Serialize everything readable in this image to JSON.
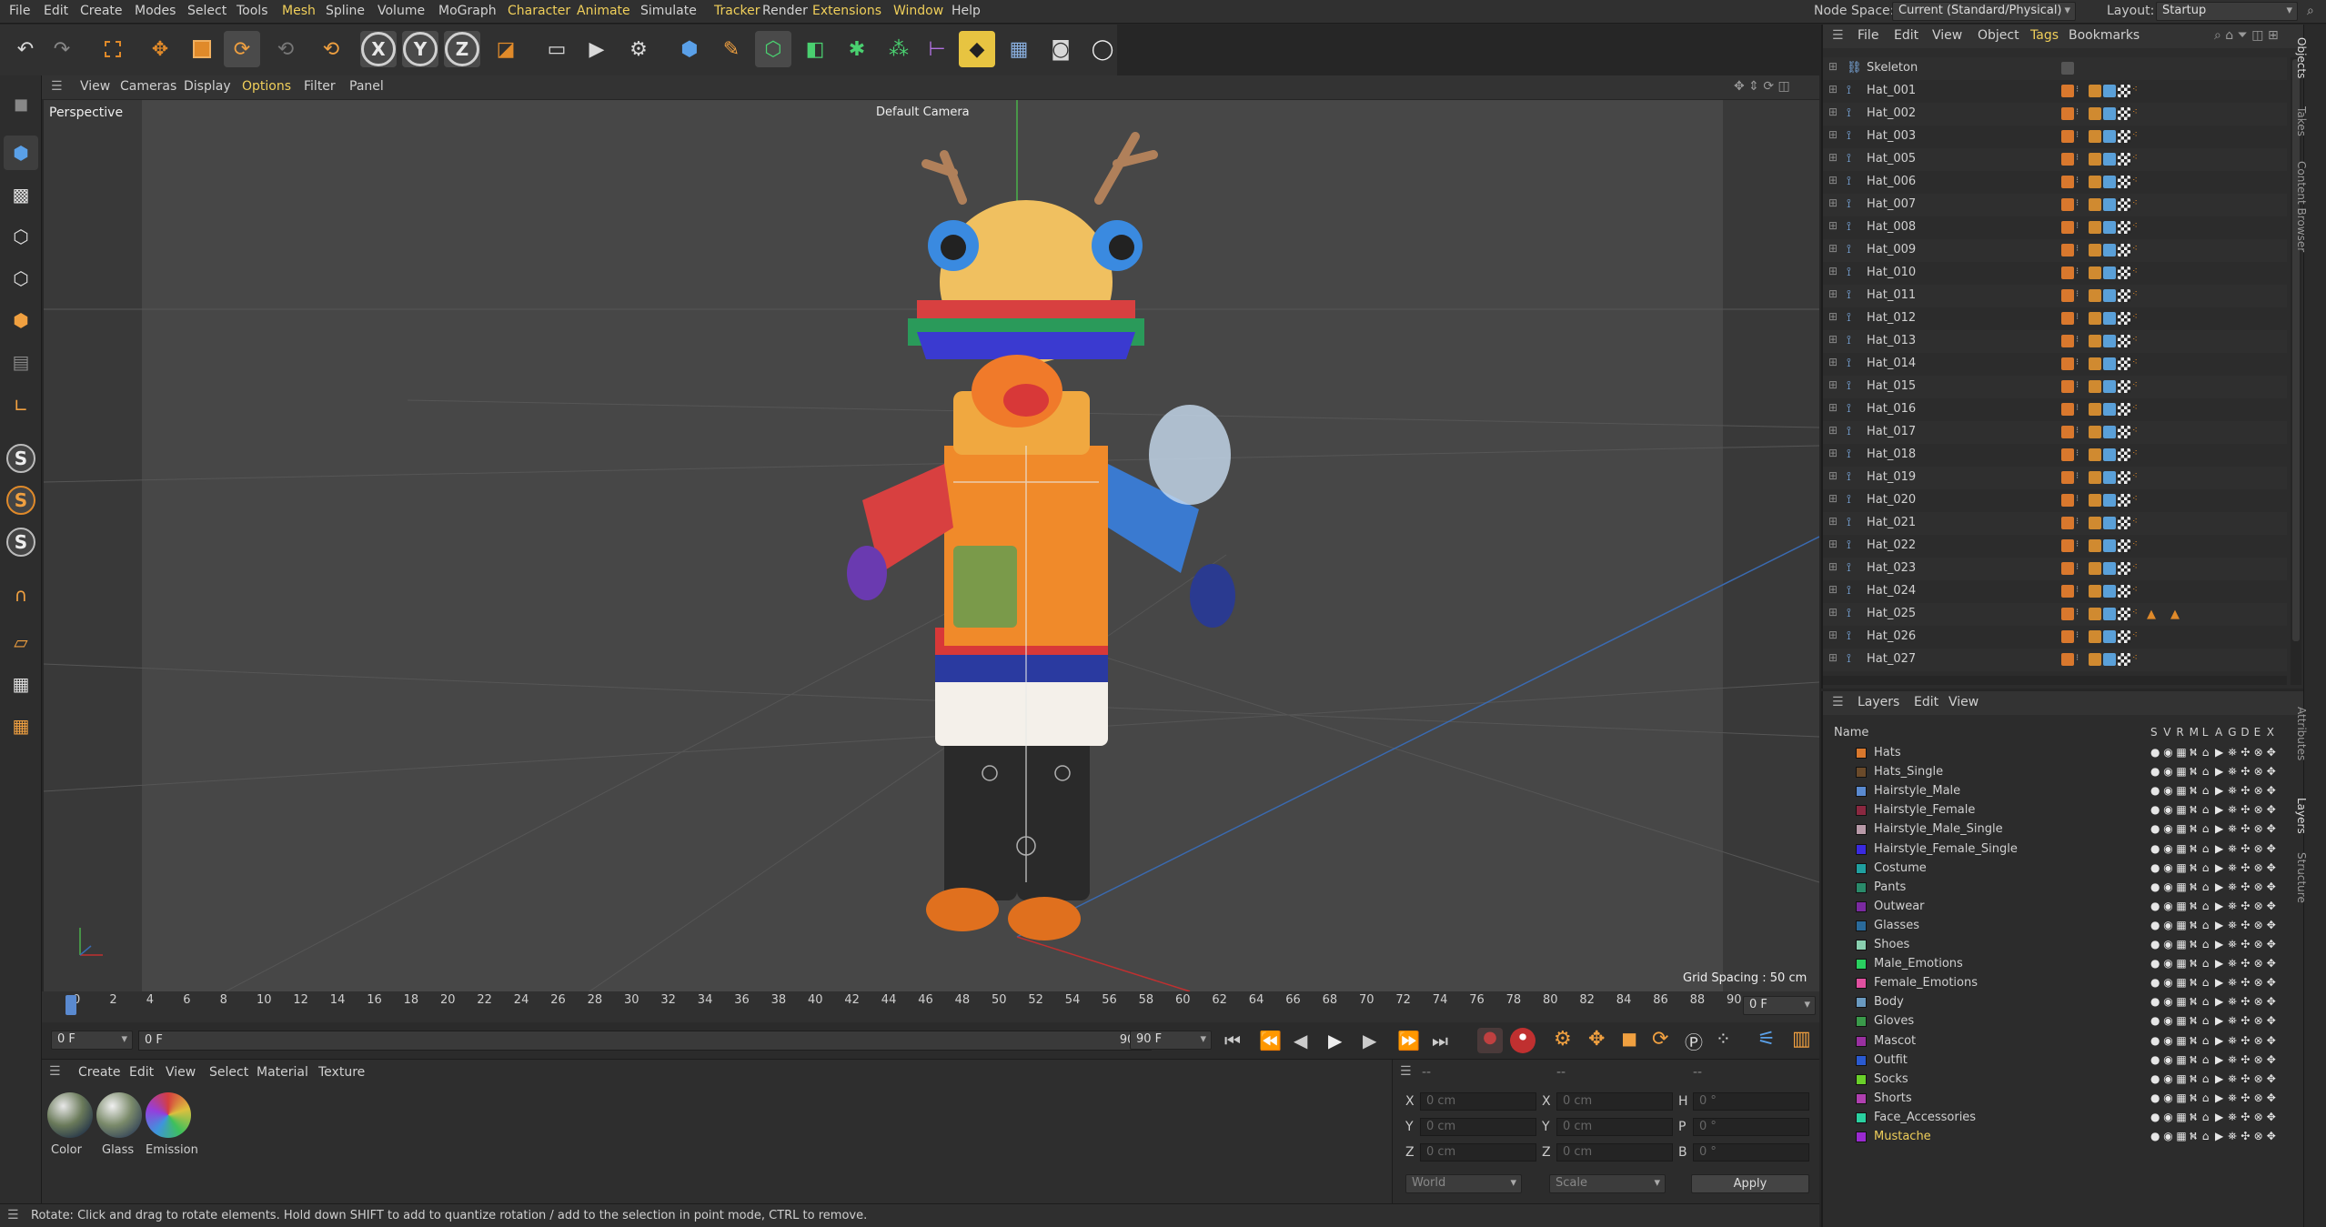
{
  "menubar": {
    "items": [
      "File",
      "Edit",
      "Create",
      "Modes",
      "Select",
      "Tools",
      "Mesh",
      "Spline",
      "Volume",
      "MoGraph",
      "Character",
      "Animate",
      "Simulate",
      "Tracker",
      "Render",
      "Extensions",
      "Window",
      "Help"
    ],
    "node_space_label": "Node Space:",
    "node_space_value": "Current (Standard/Physical)",
    "layout_label": "Layout:",
    "layout_value": "Startup"
  },
  "toolbar": {
    "axis_x": "X",
    "axis_y": "Y",
    "axis_z": "Z"
  },
  "viewport": {
    "menu": [
      "View",
      "Cameras",
      "Display",
      "Options",
      "Filter",
      "Panel"
    ],
    "view_name": "Perspective",
    "camera_label": "Default Camera",
    "grid_spacing": "Grid Spacing : 50 cm"
  },
  "timeline": {
    "ticks": [
      "0",
      "2",
      "4",
      "6",
      "8",
      "10",
      "12",
      "14",
      "16",
      "18",
      "20",
      "22",
      "24",
      "26",
      "28",
      "30",
      "32",
      "34",
      "36",
      "38",
      "40",
      "42",
      "44",
      "46",
      "48",
      "50",
      "52",
      "54",
      "56",
      "58",
      "60",
      "62",
      "64",
      "66",
      "68",
      "70",
      "72",
      "74",
      "76",
      "78",
      "80",
      "82",
      "84",
      "86",
      "88",
      "90"
    ],
    "current_frame": "0 F",
    "start_frame": "0 F",
    "range_start": "0 F",
    "range_end": "90 F",
    "end_frame": "90 F",
    "current_frame_right": "0 F"
  },
  "material_panel": {
    "menu": [
      "Create",
      "Edit",
      "View",
      "Select",
      "Material",
      "Texture"
    ],
    "materials": [
      "Color",
      "Glass",
      "Emission"
    ]
  },
  "coord_panel": {
    "dash_a": "--",
    "dash_b": "--",
    "dash_c": "--",
    "rows": [
      {
        "a": "X",
        "av": "0 cm",
        "b": "X",
        "bv": "0 cm",
        "c": "H",
        "cv": "0 °"
      },
      {
        "a": "Y",
        "av": "0 cm",
        "b": "Y",
        "bv": "0 cm",
        "c": "P",
        "cv": "0 °"
      },
      {
        "a": "Z",
        "av": "0 cm",
        "b": "Z",
        "bv": "0 cm",
        "c": "B",
        "cv": "0 °"
      }
    ],
    "mode1": "World",
    "mode2": "Scale",
    "apply": "Apply"
  },
  "status": "Rotate: Click and drag to rotate elements. Hold down SHIFT to add to quantize rotation / add to the selection in point mode, CTRL to remove.",
  "objects": {
    "menu": [
      "File",
      "Edit",
      "View",
      "Object",
      "Tags",
      "Bookmarks"
    ],
    "items": [
      "Skeleton",
      "Hat_001",
      "Hat_002",
      "Hat_003",
      "Hat_005",
      "Hat_006",
      "Hat_007",
      "Hat_008",
      "Hat_009",
      "Hat_010",
      "Hat_011",
      "Hat_012",
      "Hat_013",
      "Hat_014",
      "Hat_015",
      "Hat_016",
      "Hat_017",
      "Hat_018",
      "Hat_019",
      "Hat_020",
      "Hat_021",
      "Hat_022",
      "Hat_023",
      "Hat_024",
      "Hat_025",
      "Hat_026",
      "Hat_027"
    ]
  },
  "layers": {
    "menu": [
      "Layers",
      "Edit",
      "View"
    ],
    "header_name": "Name",
    "header_flags": [
      "S",
      "V",
      "R",
      "M",
      "L",
      "A",
      "G",
      "D",
      "E",
      "X"
    ],
    "items": [
      {
        "name": "Hats",
        "color": "#d9782d"
      },
      {
        "name": "Hats_Single",
        "color": "#6a4a2a"
      },
      {
        "name": "Hairstyle_Male",
        "color": "#5a8ad0"
      },
      {
        "name": "Hairstyle_Female",
        "color": "#8a2840"
      },
      {
        "name": "Hairstyle_Male_Single",
        "color": "#b89aa8"
      },
      {
        "name": "Hairstyle_Female_Single",
        "color": "#3a2ae0"
      },
      {
        "name": "Costume",
        "color": "#20a0a0"
      },
      {
        "name": "Pants",
        "color": "#2a8a6a"
      },
      {
        "name": "Outwear",
        "color": "#7a2aa0"
      },
      {
        "name": "Glasses",
        "color": "#2a6a9a"
      },
      {
        "name": "Shoes",
        "color": "#8ad0b0"
      },
      {
        "name": "Male_Emotions",
        "color": "#2ad060"
      },
      {
        "name": "Female_Emotions",
        "color": "#e050a0"
      },
      {
        "name": "Body",
        "color": "#6a9ac0"
      },
      {
        "name": "Gloves",
        "color": "#3a9a4a"
      },
      {
        "name": "Mascot",
        "color": "#9a30a0"
      },
      {
        "name": "Outfit",
        "color": "#2a5ad0"
      },
      {
        "name": "Socks",
        "color": "#6ad02a"
      },
      {
        "name": "Shorts",
        "color": "#b040b0"
      },
      {
        "name": "Face_Accessories",
        "color": "#2ad0a0"
      },
      {
        "name": "Mustache",
        "color": "#9a2ad0",
        "highlight": true
      }
    ]
  },
  "side_tabs": [
    "Objects",
    "Takes",
    "Content Browser",
    "Attributes",
    "Layers",
    "Structure"
  ],
  "accent": "#f0cf5a"
}
